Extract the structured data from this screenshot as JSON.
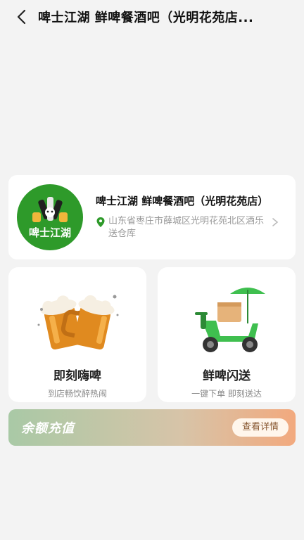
{
  "header": {
    "title": "啤士江湖 鲜啤餐酒吧（光明花苑店..."
  },
  "store": {
    "name": "啤士江湖 鲜啤餐酒吧（光明花苑店）",
    "address": "山东省枣庄市薛城区光明花苑北区酒乐送仓库",
    "logo_text": "啤士江湖"
  },
  "services": [
    {
      "title": "即刻嗨啤",
      "subtitle": "到店畅饮醉热闹"
    },
    {
      "title": "鲜啤闪送",
      "subtitle": "一键下单 即刻送达"
    }
  ],
  "recharge": {
    "label": "余额充值",
    "button": "查看详情"
  },
  "colors": {
    "logo_green": "#2e9a2a",
    "page_bg": "#f3f3f3",
    "card_bg": "#ffffff"
  }
}
